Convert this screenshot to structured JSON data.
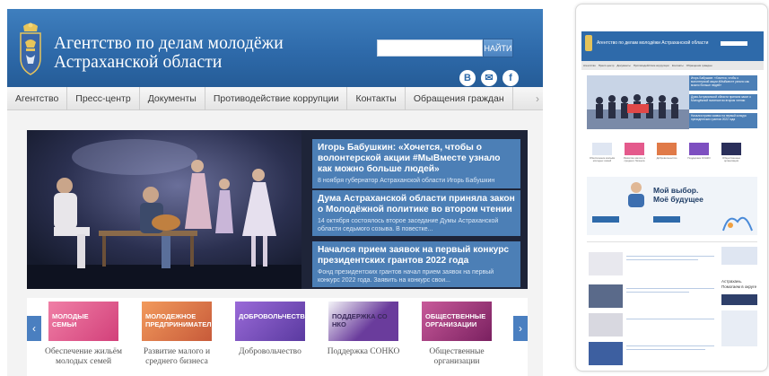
{
  "header": {
    "title_line1": "Агентство по делам молодёжи",
    "title_line2": "Астраханской области",
    "search_button": "НАЙТИ",
    "social": [
      "B",
      "✉",
      "f"
    ]
  },
  "menu": {
    "items": [
      "Агентство",
      "Пресс-центр",
      "Документы",
      "Противодействие коррупции",
      "Контакты",
      "Обращения граждан"
    ],
    "arrow": "›"
  },
  "news": [
    {
      "title": "Игорь Бабушкин: «Хочется, чтобы о волонтерской акции #МыВместе узнало как можно больше людей»",
      "text": "8 ноября губернатор Астраханской области Игорь Бабушкин"
    },
    {
      "title": "Дума Астраханской области приняла закон о Молодёжной политике во втором чтении",
      "text": "14 октября состоялось второе заседание Думы Астраханской области седьмого созыва. В повестке..."
    },
    {
      "title": "Начался прием заявок на первый конкурс президентских грантов 2022 года",
      "text": "Фонд президентских грантов начал прием заявок на первый конкурс 2022 года. Заявить на конкурс свои..."
    }
  ],
  "carousel": {
    "prev": "‹",
    "next": "›",
    "tiles": [
      {
        "label": "Молодые семьи",
        "caption": "Обеспечение жильём молодых семей",
        "color": "#e45a8c"
      },
      {
        "label": "Молодежное предпринимательство",
        "caption": "Развитие малого и среднего бизнеса",
        "color": "#e07a48"
      },
      {
        "label": "Добровольчество",
        "caption": "Добровольчество",
        "color": "#7d4fc0"
      },
      {
        "label": "Поддержка СО НКО",
        "caption": "Поддержка СОНКО",
        "color": "#6a3c9c"
      },
      {
        "label": "Общественные организации",
        "caption": "Общественные организации",
        "color": "#a8307a"
      }
    ]
  },
  "mobile": {
    "title": "Агентство по делам молодёжи Астраханской области",
    "menu": [
      "Агентство",
      "Пресс-центр",
      "Документы",
      "Противодействие коррупции",
      "Контакты",
      "Обращения граждан"
    ],
    "banner_title_1": "Мой выбор.",
    "banner_title_2": "Моё будущее",
    "banner_side_text": "Астрахань. Помогаем в округе"
  }
}
